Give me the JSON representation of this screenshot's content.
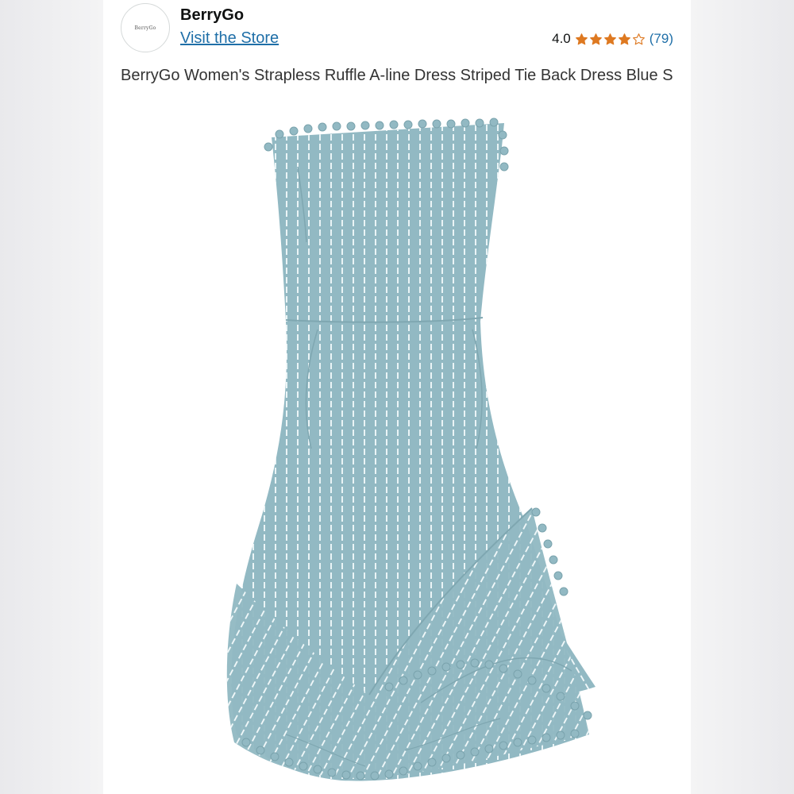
{
  "store": {
    "logo_text": "BerryGo",
    "brand_name": "BerryGo",
    "visit_label": "Visit the Store"
  },
  "rating": {
    "value": "4.0",
    "stars": 4,
    "max_stars": 5,
    "star_color": "#de7921",
    "reviews": "(79)"
  },
  "product": {
    "title": "BerryGo Women's Strapless Ruffle A-line Dress Striped Tie Back Dress Blue S",
    "image": {
      "subject": "product-photo-dress",
      "dress_color": "#92b9c3",
      "stripe_color": "#f4fafb"
    }
  },
  "colors": {
    "link": "#1f6fa8",
    "text": "#0f1111",
    "background": "#ffffff"
  }
}
